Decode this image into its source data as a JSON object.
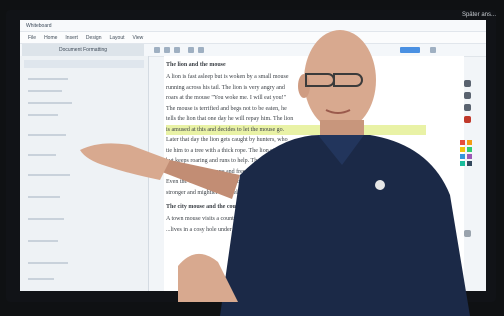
{
  "window": {
    "title": "Whiteboard",
    "caption_text": "Später ans..."
  },
  "menu": {
    "items": [
      "File",
      "Home",
      "Insert",
      "Design",
      "Layout",
      "View"
    ]
  },
  "nav_pane": {
    "tab_label": "Document Formatting"
  },
  "document": {
    "heading": "The lion and the mouse",
    "lines": [
      "A lion is fast asleep but is woken by a small mouse",
      "running across his tail. The lion is very angry and",
      "roars at the mouse \"You woke me. I will eat you!\"",
      "The mouse is terrified and begs not to be eaten, he",
      "tells the lion that one day he will repay him. The lion",
      "is amused at this and decides to let the mouse go.",
      "Later that day the lion gets caught by hunters, who",
      "tie him to a tree with a thick rope. The lion struggles",
      "but keeps roaring and runs to help. The mouse",
      "nibbles through the rope and frees the lion.",
      "Even the weak and small can be useful friends to the",
      "stronger and mightier themselves."
    ],
    "heading2": "The city mouse and the country mouse",
    "lines2": [
      "A town mouse visits a country mouse who is woken by a small",
      "...lives in a cosy hole under a tree."
    ]
  },
  "palette": {
    "colors": [
      "#e74c3c",
      "#f39c12",
      "#f1c40f",
      "#2ecc71",
      "#3498db",
      "#9b59b6",
      "#1abc9c",
      "#34495e"
    ]
  },
  "person": {
    "shirt_logo": ""
  }
}
